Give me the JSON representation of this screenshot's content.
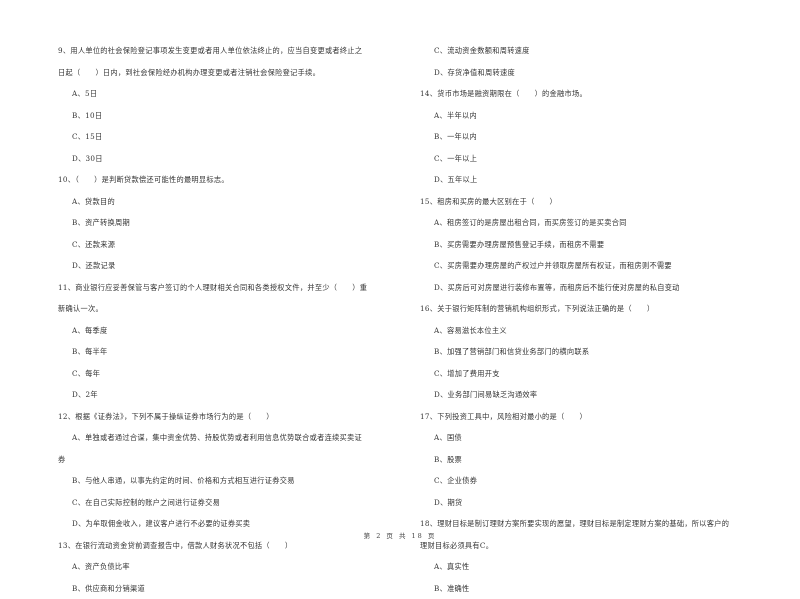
{
  "left_column": [
    {
      "type": "question",
      "lines": [
        "9、用人单位的社会保险登记事项发生变更或者用人单位依法终止的，应当自变更或者终止之",
        "日起（　　）日内，到社会保险经办机构办理变更或者注销社会保险登记手续。"
      ]
    },
    {
      "type": "option",
      "text": "A、5日"
    },
    {
      "type": "option",
      "text": "B、10日"
    },
    {
      "type": "option",
      "text": "C、15日"
    },
    {
      "type": "option",
      "text": "D、30日"
    },
    {
      "type": "question",
      "lines": [
        "10、（　　）是判断贷款偿还可能性的最明显标志。"
      ]
    },
    {
      "type": "option",
      "text": "A、贷款目的"
    },
    {
      "type": "option",
      "text": "B、资产转换周期"
    },
    {
      "type": "option",
      "text": "C、还款来源"
    },
    {
      "type": "option",
      "text": "D、还款记录"
    },
    {
      "type": "question",
      "lines": [
        "11、商业银行应妥善保管与客户签订的个人理财相关合同和各类授权文件，并至少（　　）重",
        "新确认一次。"
      ]
    },
    {
      "type": "option",
      "text": "A、每季度"
    },
    {
      "type": "option",
      "text": "B、每半年"
    },
    {
      "type": "option",
      "text": "C、每年"
    },
    {
      "type": "option",
      "text": "D、2年"
    },
    {
      "type": "question",
      "lines": [
        "12、根据《证券法》，下列不属于操纵证券市场行为的是（　　）"
      ]
    },
    {
      "type": "option",
      "lines": [
        "A、单独或者通过合谋，集中资金优势、持股优势或者利用信息优势联合或者连续买卖证",
        "券"
      ]
    },
    {
      "type": "option",
      "text": "B、与他人串通，以事先约定的时间、价格和方式相互进行证券交易"
    },
    {
      "type": "option",
      "text": "C、在自己实际控制的账户之间进行证券交易"
    },
    {
      "type": "option",
      "text": "D、为牟取佣金收入，建议客户进行不必要的证券买卖"
    },
    {
      "type": "question",
      "lines": [
        "13、在银行流动资金贷前调查报告中，借款人财务状况不包括（　　）"
      ]
    },
    {
      "type": "option",
      "text": "A、资产负债比率"
    },
    {
      "type": "option",
      "text": "B、供应商和分销渠道"
    }
  ],
  "right_column": [
    {
      "type": "option",
      "text": "C、流动资金数额和周转速度"
    },
    {
      "type": "option",
      "text": "D、存货净值和周转速度"
    },
    {
      "type": "question",
      "lines": [
        "14、货币市场是融资期限在（　　）的金融市场。"
      ]
    },
    {
      "type": "option",
      "text": "A、半年以内"
    },
    {
      "type": "option",
      "text": "B、一年以内"
    },
    {
      "type": "option",
      "text": "C、一年以上"
    },
    {
      "type": "option",
      "text": "D、五年以上"
    },
    {
      "type": "question",
      "lines": [
        "15、租房和买房的最大区别在于（　　）"
      ]
    },
    {
      "type": "option",
      "text": "A、租房签订的是房屋出租合同，而买房签订的是买卖合同"
    },
    {
      "type": "option",
      "text": "B、买房需要办理房屋预售登记手续，而租房不需要"
    },
    {
      "type": "option",
      "text": "C、买房需要办理房屋的产权过户并领取房屋所有权证，而租房则不需要"
    },
    {
      "type": "option",
      "text": "D、买房后可对房屋进行装修布置等，而租房后不能行使对房屋的私自变动"
    },
    {
      "type": "question",
      "lines": [
        "16、关于银行矩阵制的营销机构组织形式，下列说法正确的是（　　）"
      ]
    },
    {
      "type": "option",
      "text": "A、容易滋长本位主义"
    },
    {
      "type": "option",
      "text": "B、加强了营销部门和信贷业务部门的横向联系"
    },
    {
      "type": "option",
      "text": "C、增加了费用开支"
    },
    {
      "type": "option",
      "text": "D、业务部门间易缺乏沟通效率"
    },
    {
      "type": "question",
      "lines": [
        "17、下列投资工具中，风险相对最小的是（　　）"
      ]
    },
    {
      "type": "option",
      "text": "A、国债"
    },
    {
      "type": "option",
      "text": "B、股票"
    },
    {
      "type": "option",
      "text": "C、企业债券"
    },
    {
      "type": "option",
      "text": "D、期货"
    },
    {
      "type": "question",
      "lines": [
        "18、理财目标是制订理财方案所要实现的愿望，理财目标是制定理财方案的基础，所以客户的",
        "理财目标必须具有C。"
      ]
    },
    {
      "type": "option",
      "text": "A、真实性"
    },
    {
      "type": "option",
      "text": "B、准确性"
    }
  ],
  "footer": {
    "page_label": "第 2 页 共 18 页"
  }
}
